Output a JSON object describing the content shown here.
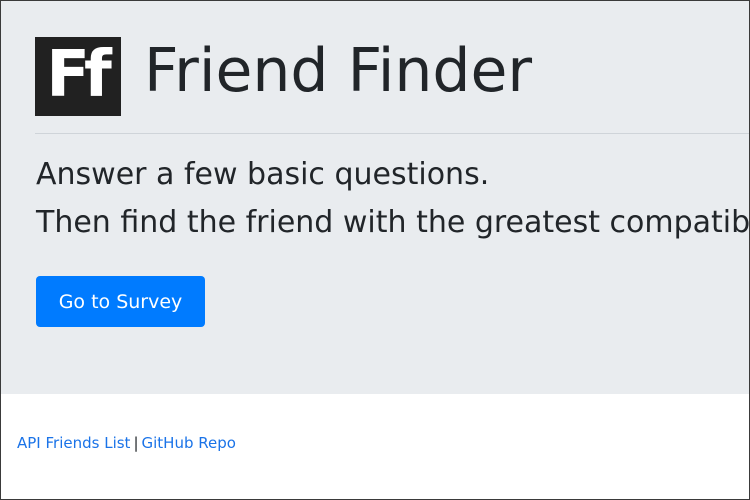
{
  "header": {
    "logo_text": "Ff",
    "title": "Friend Finder"
  },
  "hero": {
    "lead_line_1": "Answer a few basic questions.",
    "lead_line_2": "Then find the friend with the greatest compatibility.",
    "survey_button_label": "Go to Survey"
  },
  "footer": {
    "api_link_label": "API Friends List",
    "separator": "|",
    "github_link_label": "GitHub Repo"
  },
  "colors": {
    "jumbotron_bg": "#e9ecef",
    "primary_button": "#007bff",
    "link": "#1a73e8",
    "logo_bg": "#212121"
  }
}
